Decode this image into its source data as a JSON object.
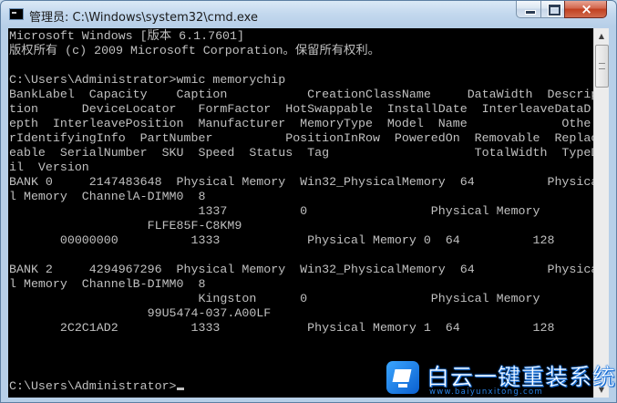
{
  "window": {
    "title": "管理员: C:\\Windows\\system32\\cmd.exe",
    "buttons": {
      "minimize": "minimize-icon",
      "maximize": "maximize-icon",
      "close": "×"
    }
  },
  "console": {
    "lines": [
      "Microsoft Windows [版本 6.1.7601]",
      "版权所有 (c) 2009 Microsoft Corporation。保留所有权利。",
      "",
      "C:\\Users\\Administrator>wmic memorychip",
      "BankLabel  Capacity    Caption           CreationClassName     DataWidth  Descrip",
      "tion      DeviceLocator   FormFactor  HotSwappable  InstallDate  InterleaveDataD",
      "epth  InterleavePosition  Manufacturer  MemoryType  Model  Name             Othe",
      "rIdentifyingInfo  PartNumber          PositionInRow  PoweredOn  Removable  Replac",
      "eable  SerialNumber  SKU  Speed  Status  Tag                    TotalWidth  TypeDetai",
      "il  Version",
      "BANK 0     2147483648  Physical Memory  Win32_PhysicalMemory  64          Physica",
      "l Memory  ChannelA-DIMM0  8",
      "                          1337          0                 Physical Memory",
      "                   FLFE85F-C8KM9",
      "       00000000          1333            Physical Memory 0  64          128",
      "",
      "BANK 2     4294967296  Physical Memory  Win32_PhysicalMemory  64          Physica",
      "l Memory  ChannelB-DIMM0  8",
      "                          Kingston      0                 Physical Memory",
      "                   99U5474-037.A00LF",
      "       2C2C1AD2          1333            Physical Memory 1  64          128",
      "",
      "",
      "",
      "C:\\Users\\Administrator>"
    ],
    "colors": {
      "background": "#000000",
      "foreground": "#c0c0c0"
    }
  },
  "scrollbar": {
    "up_arrow": "▲",
    "down_arrow": "▼"
  },
  "watermark": {
    "title": "白云一键重装系统",
    "url": "www.baiyunxitong.com",
    "logo": "baiyun-logo-icon",
    "color": "#1e78e0"
  }
}
